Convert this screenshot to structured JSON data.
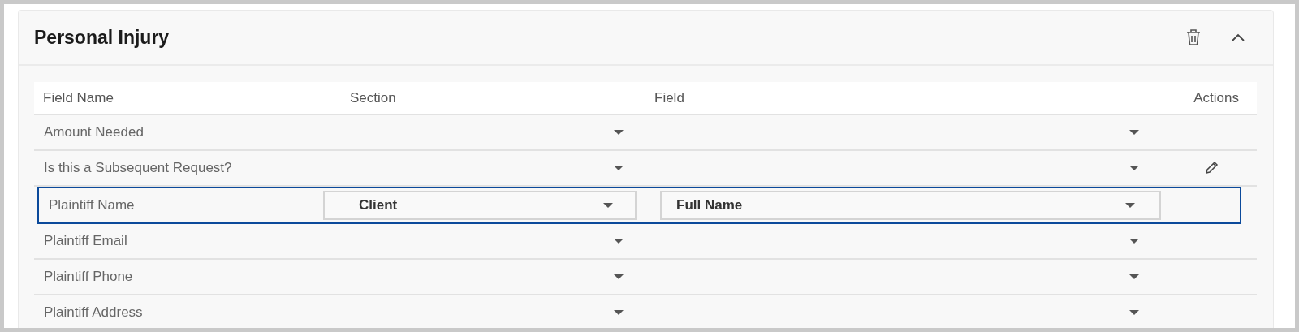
{
  "panel": {
    "title": "Personal Injury",
    "expanded": true
  },
  "table": {
    "columns": [
      "Field Name",
      "Section",
      "Field",
      "Actions"
    ],
    "rows": [
      {
        "field_name": "Amount Needed",
        "selected": false,
        "hovered": false
      },
      {
        "field_name": "Is this a Subsequent Request?",
        "selected": false,
        "hovered": true
      },
      {
        "field_name": "Plaintiff Name",
        "section": "Client",
        "field": "Full Name",
        "selected": true,
        "hovered": false
      },
      {
        "field_name": "Plaintiff Email",
        "selected": false,
        "hovered": false
      },
      {
        "field_name": "Plaintiff Phone",
        "selected": false,
        "hovered": false
      },
      {
        "field_name": "Plaintiff Address",
        "selected": false,
        "hovered": false
      }
    ]
  }
}
